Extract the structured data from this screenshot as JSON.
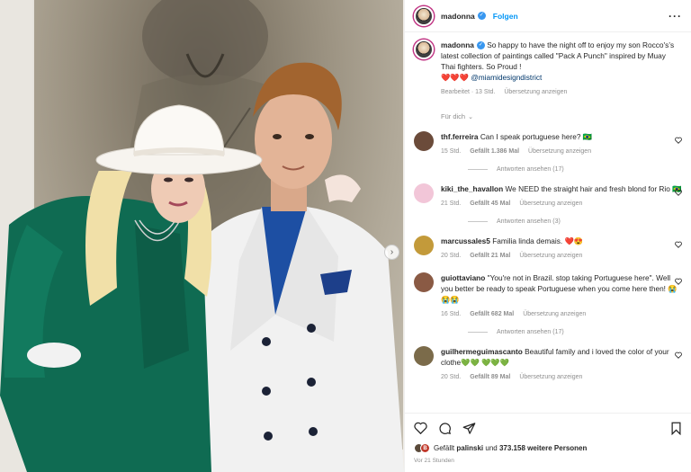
{
  "post": {
    "author": "madonna",
    "follow_label": "Folgen",
    "caption": "So happy to have the night off to enjoy my son Rocco's’s latest collection of paintings called \"Pack A Punch\" inspired by Muay Thai fighters. So Proud !",
    "caption_hearts": "❤️❤️❤️",
    "mention": "@miamidesigndistrict",
    "edited": "Bearbeitet · 13 Std.",
    "translate": "Übersetzung anzeigen",
    "fuer_dich": "Für dich"
  },
  "comments": [
    {
      "user": "thf.ferreira",
      "text": "Can I speak portuguese here? 🇧🇷",
      "time": "15 Std.",
      "likes": "Gefällt 1.386 Mal",
      "translate": "Übersetzung anzeigen",
      "replies": "Antworten ansehen (17)",
      "avatar_color": "#6b4b3a"
    },
    {
      "user": "kiki_the_havallon",
      "text": "We NEED the straight hair and fresh blond for Rio 🇧🇷",
      "time": "21 Std.",
      "likes": "Gefällt 45 Mal",
      "translate": "Übersetzung anzeigen",
      "replies": "Antworten ansehen (3)",
      "avatar_color": "#f2c6d8"
    },
    {
      "user": "marcussales5",
      "text": "Familia linda demais. ❤️😍",
      "time": "20 Std.",
      "likes": "Gefällt 21 Mal",
      "translate": "Übersetzung anzeigen",
      "replies": "",
      "avatar_color": "#c39a3a"
    },
    {
      "user": "guiottaviano",
      "text": "\"You're not in Brazil. stop taking Portuguese here\". Well you better be ready to speak Portuguese when you come here then! 😭😭😭",
      "time": "16 Std.",
      "likes": "Gefällt 682 Mal",
      "translate": "Übersetzung anzeigen",
      "replies": "Antworten ansehen (17)",
      "avatar_color": "#8a5a44"
    },
    {
      "user": "guilhermeguimascanto",
      "text": "Beautiful family and i loved the color of your clothe💚💚 💚💚💚",
      "time": "20 Std.",
      "likes": "Gefällt 89 Mal",
      "translate": "Übersetzung anzeigen",
      "replies": "",
      "avatar_color": "#7b6b4a"
    }
  ],
  "footer": {
    "liked_prefix": "Gefällt",
    "liked_user": "palinski",
    "liked_mid": "und",
    "liked_count": "373.158 weitere Personen",
    "time": "Vor 21 Stunden",
    "avatar_badge": "B"
  },
  "colors": {
    "accent": "#0095f6",
    "ring": "#c13584",
    "suit_green": "#0f6b52",
    "shirt_blue": "#1d4fa3"
  },
  "icons": [
    "heart-icon",
    "comment-icon",
    "share-icon",
    "bookmark-icon",
    "more-icon",
    "verified-icon",
    "chevron-right-icon"
  ]
}
